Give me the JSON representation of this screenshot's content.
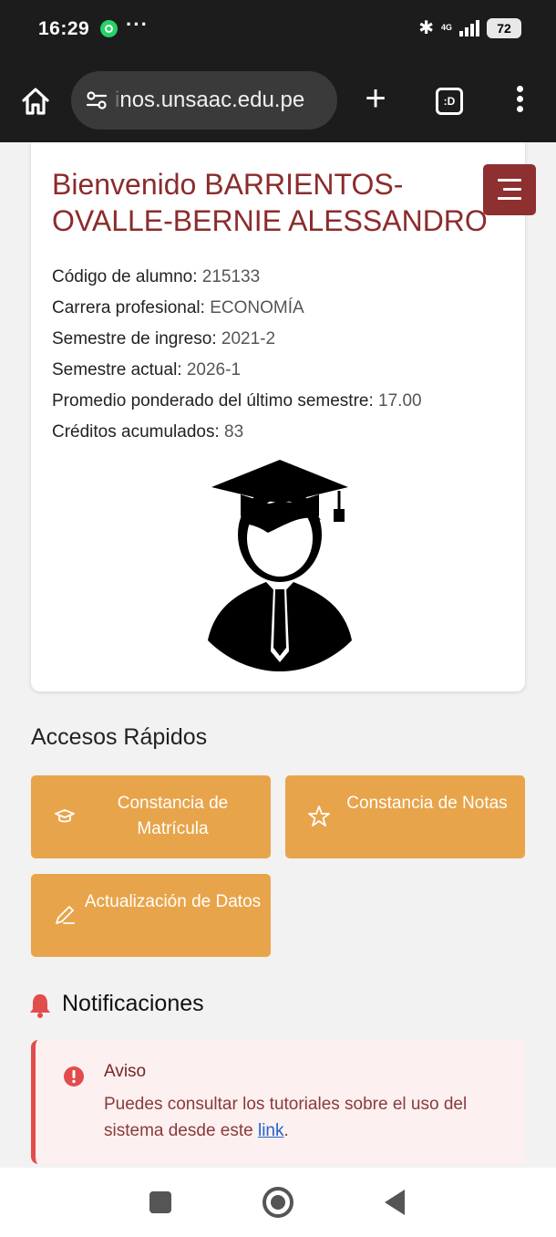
{
  "status_bar": {
    "time": "16:29",
    "dots": "···",
    "network": "4G",
    "battery": "72"
  },
  "browser": {
    "url_faded": "i",
    "url": "nos.unsaac.edu.pe",
    "tabs_label": ":D"
  },
  "welcome": {
    "title": "Bienvenido BARRIENTOS-OVALLE-BERNIE ALESSANDRO"
  },
  "student_info": [
    {
      "label": "Código de alumno:",
      "value": "215133"
    },
    {
      "label": "Carrera profesional:",
      "value": "ECONOMÍA"
    },
    {
      "label": "Semestre de ingreso:",
      "value": "2021-2"
    },
    {
      "label": "Semestre actual:",
      "value": "2026-1"
    },
    {
      "label": "Promedio ponderado del último semestre:",
      "value": "17.00"
    },
    {
      "label": "Créditos acumulados:",
      "value": "83"
    }
  ],
  "quick_access": {
    "title": "Accesos Rápidos",
    "buttons": [
      {
        "label": "Constancia de Matrícula",
        "icon": "graduation-cap-icon"
      },
      {
        "label": "Constancia de Notas",
        "icon": "star-icon"
      },
      {
        "label": "Actualización de Datos",
        "icon": "pencil-icon"
      }
    ]
  },
  "notifications": {
    "title": "Notificaciones",
    "alert_title": "Aviso",
    "alert_text": "Puedes consultar los tutoriales sobre el uso del sistema desde este",
    "alert_link": "link",
    "alert_end": "."
  },
  "colors": {
    "brand": "#8b2c2c",
    "button": "#e8a44a",
    "alert_border": "#e14d4d"
  }
}
